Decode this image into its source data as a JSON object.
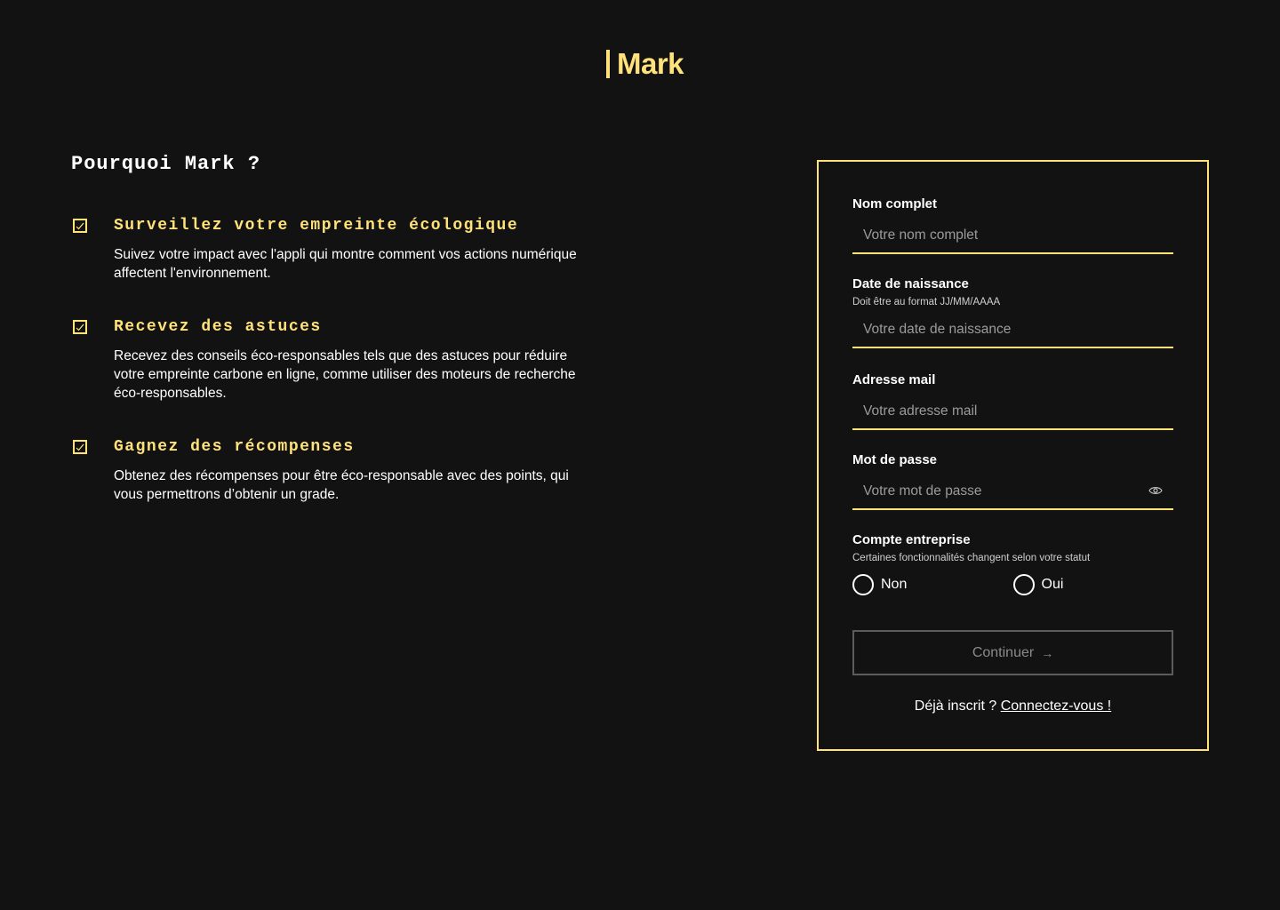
{
  "brand": {
    "name": "Mark",
    "accent_color": "#FFE27A"
  },
  "why": {
    "title": "Pourquoi Mark ?",
    "features": [
      {
        "icon": "checkbox-checked-icon",
        "title": "Surveillez votre empreinte écologique",
        "description": "Suivez votre impact avec l'appli qui montre comment vos actions numérique affectent l'environnement."
      },
      {
        "icon": "checkbox-checked-icon",
        "title": "Recevez des astuces",
        "description": "Recevez des conseils éco-responsables tels que des astuces pour réduire votre empreinte carbone en ligne, comme utiliser des moteurs de recherche éco-responsables."
      },
      {
        "icon": "checkbox-checked-icon",
        "title": "Gagnez des récompenses",
        "description": "Obtenez des récompenses pour être éco-responsable avec des points, qui vous permettrons d’obtenir un grade."
      }
    ]
  },
  "form": {
    "full_name": {
      "label": "Nom complet",
      "placeholder": "Votre nom complet",
      "value": ""
    },
    "birth_date": {
      "label": "Date de naissance",
      "hint": "Doit être au format JJ/MM/AAAA",
      "placeholder": "Votre date de naissance",
      "value": ""
    },
    "email": {
      "label": "Adresse mail",
      "placeholder": "Votre adresse mail",
      "value": ""
    },
    "password": {
      "label": "Mot de passe",
      "placeholder": "Votre mot de passe",
      "value": "",
      "toggle_icon": "eye-icon"
    },
    "business_account": {
      "label": "Compte entreprise",
      "hint": "Certaines fonctionnalités changent selon votre statut",
      "options": [
        "Non",
        "Oui"
      ]
    },
    "submit_label": "Continuer",
    "submit_icon": "arrow-right-icon",
    "login_prompt": "Déjà inscrit ?",
    "login_link": "Connectez-vous !"
  }
}
